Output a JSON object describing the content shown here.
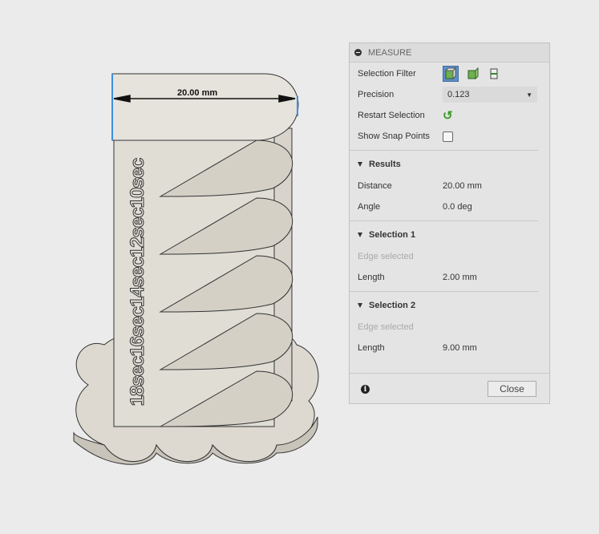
{
  "model": {
    "dimension_label": "20.00 mm",
    "engraved_text": "18sec16sec14sec12sec10sec"
  },
  "panel": {
    "title": "MEASURE",
    "selection_filter": {
      "label": "Selection Filter",
      "icons": [
        "select-body-icon",
        "select-face-icon",
        "select-edge-icon"
      ],
      "active": 0
    },
    "precision": {
      "label": "Precision",
      "value": "0.123"
    },
    "restart": {
      "label": "Restart Selection"
    },
    "snap": {
      "label": "Show Snap Points",
      "checked": false
    },
    "results": {
      "title": "Results",
      "distance_label": "Distance",
      "distance": "20.00 mm",
      "angle_label": "Angle",
      "angle": "0.0 deg"
    },
    "selection1": {
      "title": "Selection 1",
      "status": "Edge selected",
      "length_label": "Length",
      "length": "2.00 mm"
    },
    "selection2": {
      "title": "Selection 2",
      "status": "Edge selected",
      "length_label": "Length",
      "length": "9.00 mm"
    },
    "close_label": "Close",
    "accent": "#5c8fc7"
  }
}
